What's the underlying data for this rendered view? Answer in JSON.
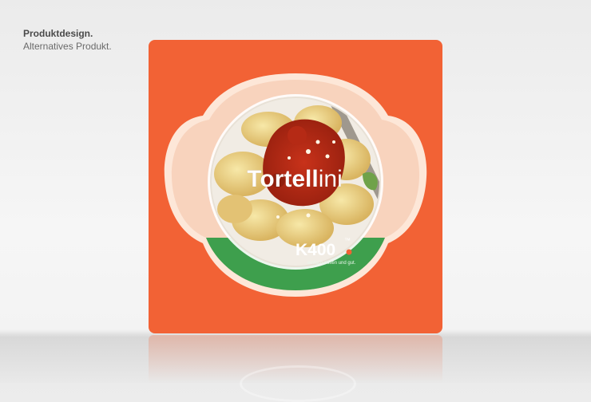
{
  "caption": {
    "title": "Produktdesign.",
    "subtitle": "Alternatives Produkt."
  },
  "product": {
    "name_part1": "Tortell",
    "name_part2": "ini",
    "brand": "K400",
    "brand_tm": "™",
    "tagline": "einfach essen und gut."
  },
  "colors": {
    "package": "#f26235",
    "band": "#3e9f4d",
    "dot": "#f26235"
  },
  "icons": {
    "plate": "plate-illustration",
    "pasta": "pasta-illustration"
  }
}
